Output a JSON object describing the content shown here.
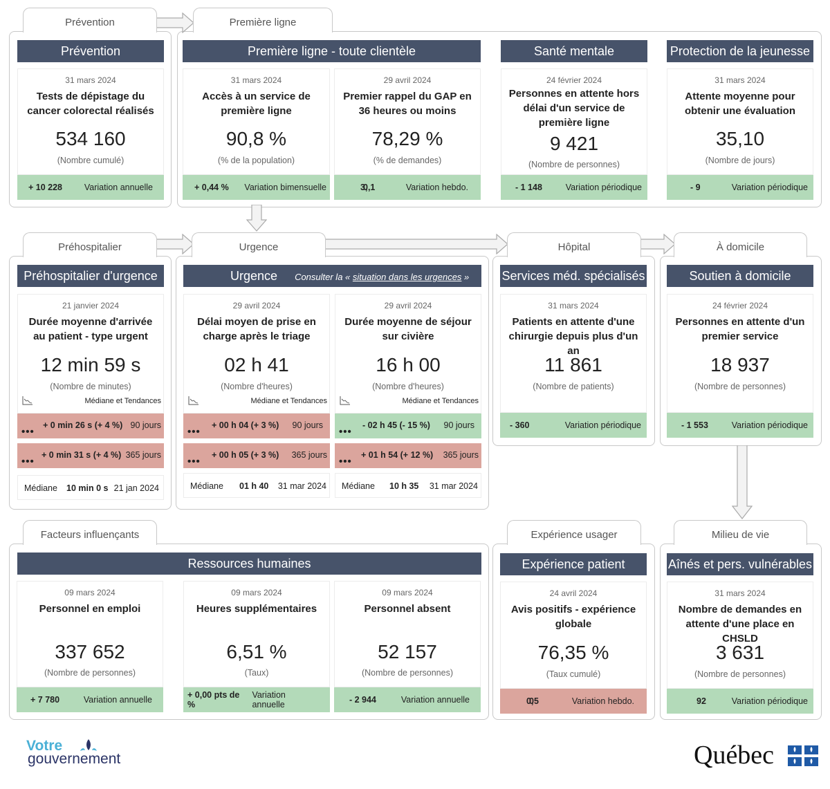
{
  "sections": {
    "prevention_tab": "Prévention",
    "premiere_ligne_tab": "Première ligne",
    "prehospitalier_tab": "Préhospitalier",
    "urgence_tab": "Urgence",
    "hopital_tab": "Hôpital",
    "domicile_tab": "À domicile",
    "facteurs_tab": "Facteurs influençants",
    "experience_tab": "Expérience usager",
    "milieu_tab": "Milieu de vie"
  },
  "headers": {
    "prevention": "Prévention",
    "premiere_ligne": "Première ligne - toute clientèle",
    "sante_mentale": "Santé mentale",
    "protection": "Protection de la jeunesse",
    "prehospitalier": "Préhospitalier d'urgence",
    "urgence": "Urgence",
    "urgence_link_prefix": "Consulter la « ",
    "urgence_link": "situation dans les urgences",
    "urgence_link_suffix": " »",
    "services_med": "Services méd. spécialisés",
    "soutien_domicile": "Soutien à domicile",
    "ressources_humaines": "Ressources humaines",
    "experience_patient": "Expérience patient",
    "aines": "Aînés et pers. vulnérables"
  },
  "cards": {
    "depistage": {
      "date": "31 mars 2024",
      "title": "Tests de dépistage du cancer colorectal réalisés",
      "value": "534 160",
      "unit": "(Nombre cumulé)",
      "variation": "+ 10 228",
      "variation_label": "Variation annuelle"
    },
    "acces": {
      "date": "31 mars 2024",
      "title": "Accès à un service de première ligne",
      "value": "90,8 %",
      "unit": "(% de la population)",
      "variation": "+ 0,44 %",
      "variation_label": "Variation bimensuelle"
    },
    "gap": {
      "date": "29 avril 2024",
      "title": "Premier rappel du GAP en 36 heures ou moins",
      "value": "78,29 %",
      "unit": "(% de demandes)",
      "variation_a": "3,",
      "variation_b": "0,1",
      "variation_label": "Variation hebdo."
    },
    "sante_mentale": {
      "date": "24 février 2024",
      "title": "Personnes en attente hors délai d'un service de première ligne",
      "value": "9 421",
      "unit": "(Nombre de personnes)",
      "variation": "- 1 148",
      "variation_label": "Variation périodique"
    },
    "protection": {
      "date": "31 mars 2024",
      "title": "Attente moyenne pour obtenir une évaluation",
      "value": "35,10",
      "unit": "(Nombre de jours)",
      "variation": "- 9",
      "variation_label": "Variation périodique"
    },
    "prehospitalier": {
      "date": "21 janvier 2024",
      "title": "Durée moyenne d'arrivée au patient - type urgent",
      "value": "12 min 59 s",
      "unit": "(Nombre de minutes)",
      "trend_label": "Médiane et Tendances",
      "trend_90": "+ 0 min 26 s (+ 4 %)",
      "trend_90_period": "90 jours",
      "trend_365": "+ 0 min 31 s (+ 4 %)",
      "trend_365_period": "365 jours",
      "median_label": "Médiane",
      "median_value": "10 min 0 s",
      "median_date": "21 jan 2024"
    },
    "triage": {
      "date": "29 avril 2024",
      "title": "Délai moyen de prise en charge après le triage",
      "value": "02 h 41",
      "unit": "(Nombre d'heures)",
      "trend_label": "Médiane et Tendances",
      "trend_90": "+ 00 h 04 (+ 3 %)",
      "trend_90_period": "90 jours",
      "trend_365": "+ 00 h 05 (+ 3 %)",
      "trend_365_period": "365 jours",
      "median_label": "Médiane",
      "median_value": "01 h 40",
      "median_date": "31 mar 2024"
    },
    "civiere": {
      "date": "29 avril 2024",
      "title": "Durée moyenne de séjour sur civière",
      "value": "16 h 00",
      "unit": "(Nombre d'heures)",
      "trend_label": "Médiane et Tendances",
      "trend_90": "- 02 h 45 (- 15 %)",
      "trend_90_period": "90 jours",
      "trend_365": "+ 01 h 54 (+ 12 %)",
      "trend_365_period": "365 jours",
      "median_label": "Médiane",
      "median_value": "10 h 35",
      "median_date": "31 mar 2024"
    },
    "chirurgie": {
      "date": "31 mars 2024",
      "title": "Patients en attente d'une chirurgie depuis plus d'un an",
      "value": "11 861",
      "unit": "(Nombre de patients)",
      "variation": "- 360",
      "variation_label": "Variation périodique"
    },
    "soutien": {
      "date": "24 février 2024",
      "title": "Personnes en attente d'un premier service",
      "value": "18 937",
      "unit": "(Nombre de personnes)",
      "variation": "- 1 553",
      "variation_label": "Variation périodique"
    },
    "emploi": {
      "date": "09 mars 2024",
      "title": "Personnel en emploi",
      "value": "337 652",
      "unit": "(Nombre de personnes)",
      "variation": "+ 7 780",
      "variation_label": "Variation annuelle"
    },
    "heures_sup": {
      "date": "09 mars 2024",
      "title": "Heures supplémentaires",
      "value": "6,51 %",
      "unit": "(Taux)",
      "variation": "+ 0,00 pts de %",
      "variation_label": "Variation annuelle"
    },
    "absent": {
      "date": "09 mars 2024",
      "title": "Personnel absent",
      "value": "52 157",
      "unit": "(Nombre de personnes)",
      "variation": "- 2 944",
      "variation_label": "Variation annuelle"
    },
    "avis": {
      "date": "24 avril 2024",
      "title": "Avis positifs - expérience globale",
      "value": "76,35 %",
      "unit": "(Taux cumulé)",
      "variation_a": "0,",
      "variation_b": "05",
      "variation_label": "Variation hebdo."
    },
    "chsld": {
      "date": "31 mars 2024",
      "title": "Nombre de demandes en attente d'une place en CHSLD",
      "value": "3 631",
      "unit": "(Nombre de personnes)",
      "variation": "92",
      "variation_label": "Variation périodique"
    }
  },
  "footer": {
    "logo_left_line1": "Votre",
    "logo_left_line2": "gouvernement",
    "logo_right": "Québec"
  },
  "colors": {
    "header": "#47536a",
    "positive": "#b3dab9",
    "negative": "#dba59d"
  }
}
